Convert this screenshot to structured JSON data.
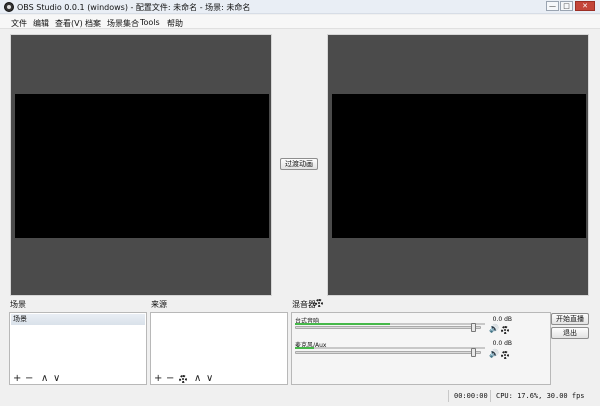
{
  "window": {
    "title": "OBS Studio 0.0.1 (windows) - 配置文件: 未命名 - 场景: 未命名",
    "minimize_label": "—",
    "maximize_label": "□",
    "close_label": "✕"
  },
  "menu": {
    "items": [
      "文件",
      "编辑",
      "查看(V)",
      "档案",
      "场景集合",
      "Tools",
      "帮助"
    ]
  },
  "transition": {
    "button_label": "过渡动画"
  },
  "scenes": {
    "label": "场景",
    "items": [
      "场景"
    ]
  },
  "sources": {
    "label": "来源",
    "items": []
  },
  "list_toolbar": {
    "add_glyph": "+",
    "remove_glyph": "−",
    "up_glyph": "∧",
    "down_glyph": "∨"
  },
  "mixer": {
    "label": "混音器",
    "channels": [
      {
        "name": "台式音响",
        "db": "0.0 dB",
        "level": 0.5,
        "volume": 0.98
      },
      {
        "name": "麦克风/Aux",
        "db": "0.0 dB",
        "level": 0.1,
        "volume": 0.98
      }
    ],
    "speaker_glyph": "🔊"
  },
  "actions": {
    "start_streaming": "开始直播",
    "exit": "退出"
  },
  "status": {
    "time": "00:00:00",
    "cpu_fps": "CPU: 17.6%, 30.00 fps"
  }
}
